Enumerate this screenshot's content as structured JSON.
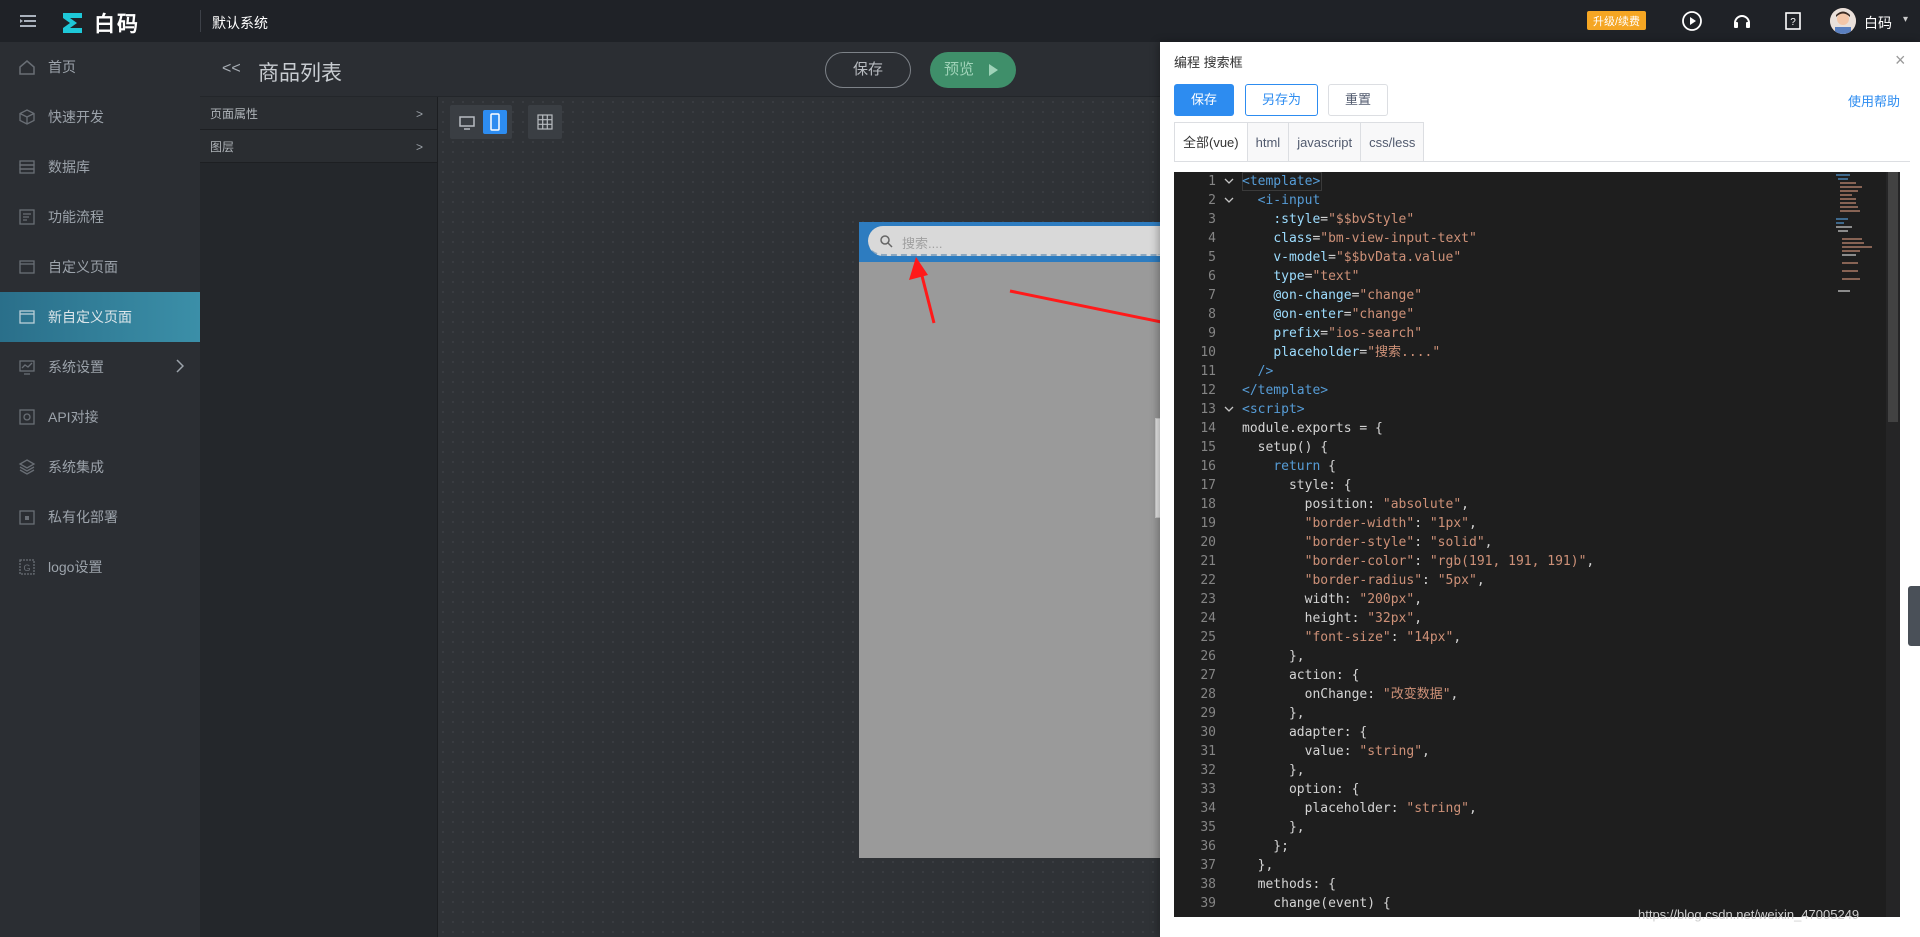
{
  "topbar": {
    "brand": "白码",
    "system_name": "默认系统",
    "upgrade_label": "升级/续费",
    "user_name": "白码"
  },
  "sidebar": {
    "items": [
      {
        "label": "首页",
        "icon": "home-icon",
        "active": false
      },
      {
        "label": "快速开发",
        "icon": "cube-icon",
        "active": false
      },
      {
        "label": "数据库",
        "icon": "database-icon",
        "active": false
      },
      {
        "label": "功能流程",
        "icon": "flow-icon",
        "active": false
      },
      {
        "label": "自定义页面",
        "icon": "page-icon",
        "active": false
      },
      {
        "label": "新自定义页面",
        "icon": "page-icon",
        "active": true
      },
      {
        "label": "系统设置",
        "icon": "settings-icon",
        "active": false,
        "has_arrow": true
      },
      {
        "label": "API对接",
        "icon": "api-icon",
        "active": false
      },
      {
        "label": "系统集成",
        "icon": "layers-icon",
        "active": false
      },
      {
        "label": "私有化部署",
        "icon": "lock-icon",
        "active": false
      },
      {
        "label": "logo设置",
        "icon": "logo-icon",
        "active": false
      }
    ]
  },
  "editor": {
    "back_glyph": "<<",
    "title": "商品列表",
    "save_label": "保存",
    "preview_label": "预览"
  },
  "props": {
    "rows": [
      "页面属性",
      "图层"
    ]
  },
  "canvas": {
    "search_placeholder": "搜索...."
  },
  "drawer": {
    "title": "编程 搜索框",
    "save_label": "保存",
    "save_as_label": "另存为",
    "reset_label": "重置",
    "help_label": "使用帮助",
    "close_glyph": "×",
    "tabs": [
      "全部(vue)",
      "html",
      "javascript",
      "css/less"
    ],
    "active_tab": 0
  },
  "code": {
    "lines": [
      {
        "n": "1",
        "fold": true,
        "parts": [
          [
            "t-tag",
            "<template>"
          ]
        ]
      },
      {
        "n": "2",
        "fold": true,
        "parts": [
          [
            "t-txt",
            "  "
          ],
          [
            "t-tag",
            "<i-input"
          ]
        ]
      },
      {
        "n": "3",
        "parts": [
          [
            "t-txt",
            "    "
          ],
          [
            "t-attr",
            ":style"
          ],
          [
            "t-txt",
            "="
          ],
          [
            "t-str",
            "\"$$bvStyle\""
          ]
        ]
      },
      {
        "n": "4",
        "parts": [
          [
            "t-txt",
            "    "
          ],
          [
            "t-attr",
            "class"
          ],
          [
            "t-txt",
            "="
          ],
          [
            "t-str",
            "\"bm-view-input-text\""
          ]
        ]
      },
      {
        "n": "5",
        "parts": [
          [
            "t-txt",
            "    "
          ],
          [
            "t-attr",
            "v-model"
          ],
          [
            "t-txt",
            "="
          ],
          [
            "t-str",
            "\"$$bvData.value\""
          ]
        ]
      },
      {
        "n": "6",
        "parts": [
          [
            "t-txt",
            "    "
          ],
          [
            "t-attr",
            "type"
          ],
          [
            "t-txt",
            "="
          ],
          [
            "t-str",
            "\"text\""
          ]
        ]
      },
      {
        "n": "7",
        "parts": [
          [
            "t-txt",
            "    "
          ],
          [
            "t-attr",
            "@on-change"
          ],
          [
            "t-txt",
            "="
          ],
          [
            "t-str",
            "\"change\""
          ]
        ]
      },
      {
        "n": "8",
        "parts": [
          [
            "t-txt",
            "    "
          ],
          [
            "t-attr",
            "@on-enter"
          ],
          [
            "t-txt",
            "="
          ],
          [
            "t-str",
            "\"change\""
          ]
        ]
      },
      {
        "n": "9",
        "parts": [
          [
            "t-txt",
            "    "
          ],
          [
            "t-attr",
            "prefix"
          ],
          [
            "t-txt",
            "="
          ],
          [
            "t-str",
            "\"ios-search\""
          ]
        ]
      },
      {
        "n": "10",
        "parts": [
          [
            "t-txt",
            "    "
          ],
          [
            "t-attr",
            "placeholder"
          ],
          [
            "t-txt",
            "="
          ],
          [
            "t-str",
            "\"搜索....\""
          ]
        ]
      },
      {
        "n": "11",
        "parts": [
          [
            "t-txt",
            "  "
          ],
          [
            "t-tag",
            "/>"
          ]
        ]
      },
      {
        "n": "12",
        "parts": [
          [
            "t-tag",
            "</template>"
          ]
        ]
      },
      {
        "n": "13",
        "fold": true,
        "parts": [
          [
            "t-tag",
            "<script>"
          ]
        ]
      },
      {
        "n": "14",
        "parts": [
          [
            "t-txt",
            "module.exports = {"
          ]
        ]
      },
      {
        "n": "15",
        "parts": [
          [
            "t-txt",
            "  setup() {"
          ]
        ]
      },
      {
        "n": "16",
        "parts": [
          [
            "t-txt",
            "    "
          ],
          [
            "t-key",
            "return"
          ],
          [
            "t-txt",
            " {"
          ]
        ]
      },
      {
        "n": "17",
        "parts": [
          [
            "t-txt",
            "      style: {"
          ]
        ]
      },
      {
        "n": "18",
        "parts": [
          [
            "t-txt",
            "        position: "
          ],
          [
            "t-str",
            "\"absolute\""
          ],
          [
            "t-txt",
            ","
          ]
        ]
      },
      {
        "n": "19",
        "parts": [
          [
            "t-txt",
            "        "
          ],
          [
            "t-str",
            "\"border-width\""
          ],
          [
            "t-txt",
            ": "
          ],
          [
            "t-str",
            "\"1px\""
          ],
          [
            "t-txt",
            ","
          ]
        ]
      },
      {
        "n": "20",
        "parts": [
          [
            "t-txt",
            "        "
          ],
          [
            "t-str",
            "\"border-style\""
          ],
          [
            "t-txt",
            ": "
          ],
          [
            "t-str",
            "\"solid\""
          ],
          [
            "t-txt",
            ","
          ]
        ]
      },
      {
        "n": "21",
        "parts": [
          [
            "t-txt",
            "        "
          ],
          [
            "t-str",
            "\"border-color\""
          ],
          [
            "t-txt",
            ": "
          ],
          [
            "t-str",
            "\"rgb(191, 191, 191)\""
          ],
          [
            "t-txt",
            ","
          ]
        ]
      },
      {
        "n": "22",
        "parts": [
          [
            "t-txt",
            "        "
          ],
          [
            "t-str",
            "\"border-radius\""
          ],
          [
            "t-txt",
            ": "
          ],
          [
            "t-str",
            "\"5px\""
          ],
          [
            "t-txt",
            ","
          ]
        ]
      },
      {
        "n": "23",
        "parts": [
          [
            "t-txt",
            "        width: "
          ],
          [
            "t-str",
            "\"200px\""
          ],
          [
            "t-txt",
            ","
          ]
        ]
      },
      {
        "n": "24",
        "parts": [
          [
            "t-txt",
            "        height: "
          ],
          [
            "t-str",
            "\"32px\""
          ],
          [
            "t-txt",
            ","
          ]
        ]
      },
      {
        "n": "25",
        "parts": [
          [
            "t-txt",
            "        "
          ],
          [
            "t-str",
            "\"font-size\""
          ],
          [
            "t-txt",
            ": "
          ],
          [
            "t-str",
            "\"14px\""
          ],
          [
            "t-txt",
            ","
          ]
        ]
      },
      {
        "n": "26",
        "parts": [
          [
            "t-txt",
            "      },"
          ]
        ]
      },
      {
        "n": "27",
        "parts": [
          [
            "t-txt",
            "      action: {"
          ]
        ]
      },
      {
        "n": "28",
        "parts": [
          [
            "t-txt",
            "        onChange: "
          ],
          [
            "t-str",
            "\"改变数据\""
          ],
          [
            "t-txt",
            ","
          ]
        ]
      },
      {
        "n": "29",
        "parts": [
          [
            "t-txt",
            "      },"
          ]
        ]
      },
      {
        "n": "30",
        "parts": [
          [
            "t-txt",
            "      adapter: {"
          ]
        ]
      },
      {
        "n": "31",
        "parts": [
          [
            "t-txt",
            "        value: "
          ],
          [
            "t-str",
            "\"string\""
          ],
          [
            "t-txt",
            ","
          ]
        ]
      },
      {
        "n": "32",
        "parts": [
          [
            "t-txt",
            "      },"
          ]
        ]
      },
      {
        "n": "33",
        "parts": [
          [
            "t-txt",
            "      option: {"
          ]
        ]
      },
      {
        "n": "34",
        "parts": [
          [
            "t-txt",
            "        placeholder: "
          ],
          [
            "t-str",
            "\"string\""
          ],
          [
            "t-txt",
            ","
          ]
        ]
      },
      {
        "n": "35",
        "parts": [
          [
            "t-txt",
            "      },"
          ]
        ]
      },
      {
        "n": "36",
        "parts": [
          [
            "t-txt",
            "    };"
          ]
        ]
      },
      {
        "n": "37",
        "parts": [
          [
            "t-txt",
            "  },"
          ]
        ]
      },
      {
        "n": "38",
        "parts": [
          [
            "t-txt",
            "  methods: {"
          ]
        ]
      },
      {
        "n": "39",
        "parts": [
          [
            "t-txt",
            "    change(event) {"
          ]
        ]
      }
    ]
  },
  "watermark": "https://blog.csdn.net/weixin_47005249",
  "colors": {
    "accent": "#2d8cf0",
    "active_sidebar": "#3b8fa8",
    "topbar": "#1f2227",
    "upgrade": "#f5a623"
  }
}
